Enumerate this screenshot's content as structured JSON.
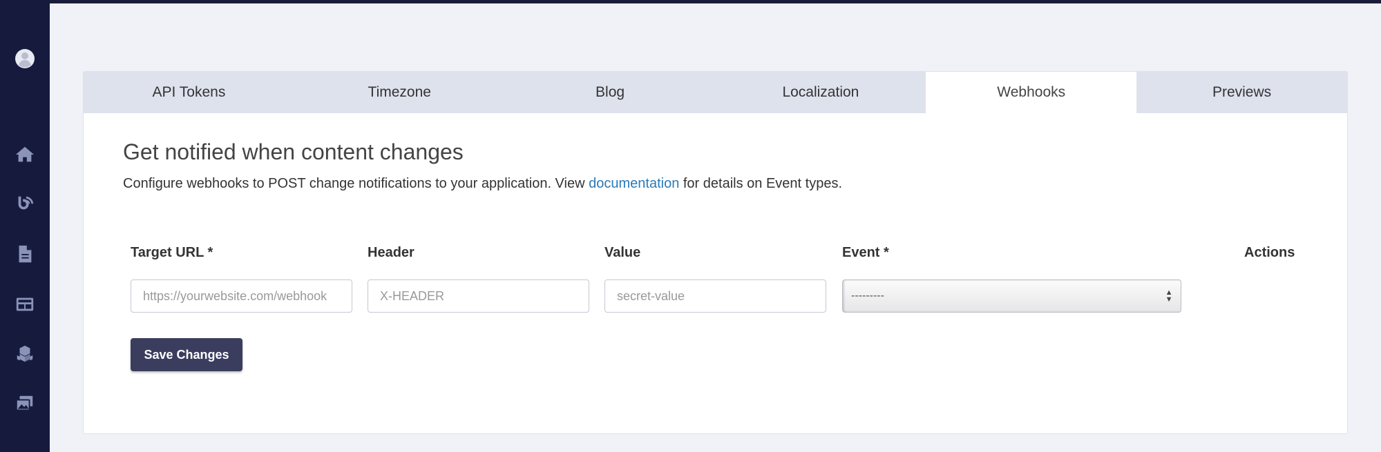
{
  "sidebar": {
    "icons": [
      "user-avatar-icon",
      "home-icon",
      "blog-icon",
      "document-icon",
      "layout-icon",
      "components-icon",
      "media-icon"
    ]
  },
  "tabs": [
    {
      "label": "API Tokens",
      "active": false
    },
    {
      "label": "Timezone",
      "active": false
    },
    {
      "label": "Blog",
      "active": false
    },
    {
      "label": "Localization",
      "active": false
    },
    {
      "label": "Webhooks",
      "active": true
    },
    {
      "label": "Previews",
      "active": false
    }
  ],
  "main": {
    "title": "Get notified when content changes",
    "description_before": "Configure webhooks to POST change notifications to your application. View ",
    "doc_link": "documentation",
    "description_after": " for details on Event types."
  },
  "form": {
    "labels": {
      "target_url": "Target URL *",
      "header": "Header",
      "value": "Value",
      "event": "Event *",
      "actions": "Actions"
    },
    "placeholders": {
      "target_url": "https://yourwebsite.com/webhook",
      "header": "X-HEADER",
      "value": "secret-value"
    },
    "event_selected": "---------",
    "save_label": "Save Changes"
  },
  "colors": {
    "sidebar": "#161b3d",
    "button": "#3a3d5e",
    "link": "#2a7ab8",
    "tabs_bg": "#dee2ed"
  }
}
